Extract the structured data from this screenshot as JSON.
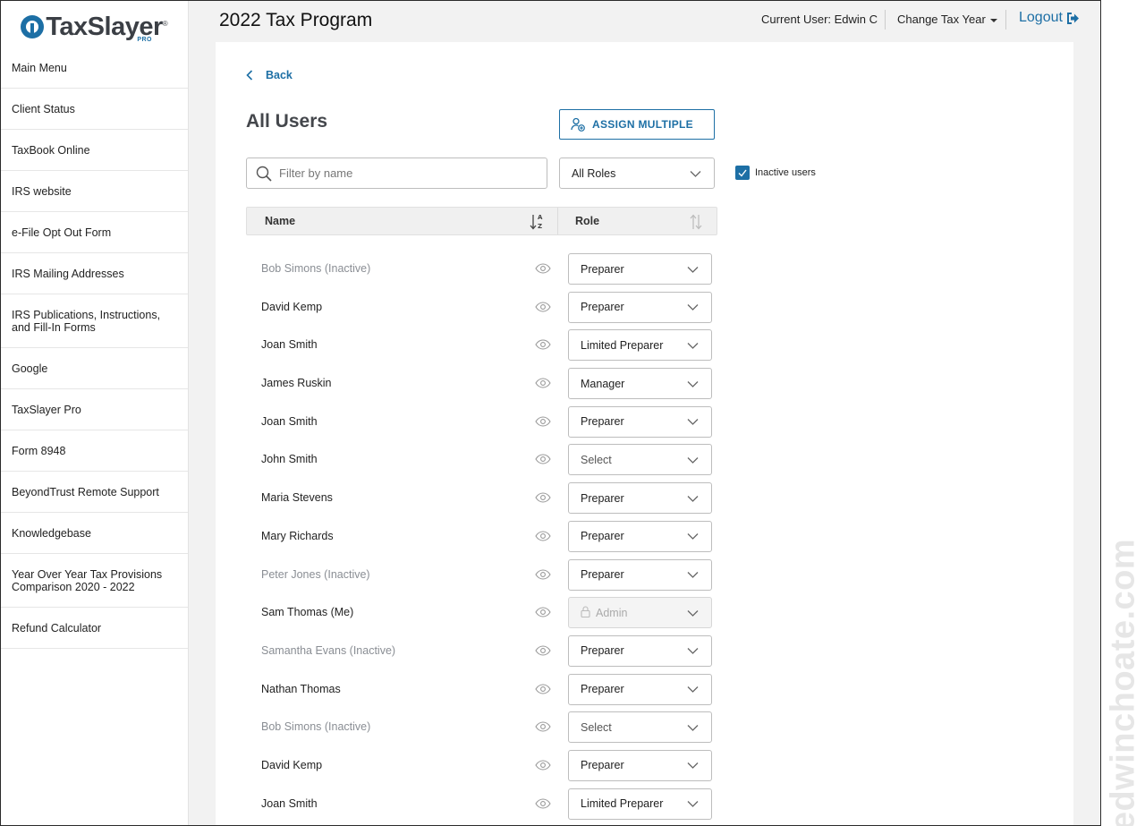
{
  "brand": {
    "name": "TaxSlayer",
    "reg": "®",
    "sub": "PRO"
  },
  "header": {
    "title": "2022 Tax Program",
    "current_user": "Current User: Edwin C",
    "change_year": "Change Tax Year",
    "logout": "Logout"
  },
  "sidebar": {
    "items": [
      {
        "label": "Main Menu"
      },
      {
        "label": "Client Status"
      },
      {
        "label": "TaxBook Online"
      },
      {
        "label": "IRS website"
      },
      {
        "label": "e-File Opt Out Form"
      },
      {
        "label": "IRS Mailing Addresses"
      },
      {
        "label": "IRS Publications, Instructions, and Fill-In Forms"
      },
      {
        "label": "Google"
      },
      {
        "label": "TaxSlayer Pro"
      },
      {
        "label": "Form 8948"
      },
      {
        "label": "BeyondTrust Remote Support"
      },
      {
        "label": "Knowledgebase"
      },
      {
        "label": "Year Over Year Tax Provisions Comparison 2020 - 2022"
      },
      {
        "label": "Refund Calculator"
      }
    ]
  },
  "main": {
    "back_label": "Back",
    "title": "All Users",
    "assign_label": "ASSIGN MULTIPLE",
    "filter_placeholder": "Filter by name",
    "roles_filter": "All Roles",
    "inactive_label": "Inactive users",
    "inactive_checked": true,
    "columns": {
      "name": "Name",
      "role": "Role"
    },
    "users": [
      {
        "name": "Bob Simons (Inactive)",
        "role": "Preparer",
        "inactive": true
      },
      {
        "name": "David Kemp",
        "role": "Preparer"
      },
      {
        "name": "Joan Smith",
        "role": "Limited Preparer"
      },
      {
        "name": "James Ruskin",
        "role": "Manager"
      },
      {
        "name": "Joan Smith",
        "role": "Preparer"
      },
      {
        "name": "John Smith",
        "role": "Select",
        "placeholder": true
      },
      {
        "name": "Maria Stevens",
        "role": "Preparer"
      },
      {
        "name": "Mary Richards",
        "role": "Preparer"
      },
      {
        "name": "Peter Jones (Inactive)",
        "role": "Preparer",
        "inactive": true
      },
      {
        "name": "Sam Thomas (Me)",
        "role": "Admin",
        "locked": true
      },
      {
        "name": "Samantha Evans (Inactive)",
        "role": "Preparer",
        "inactive": true
      },
      {
        "name": "Nathan Thomas",
        "role": "Preparer"
      },
      {
        "name": "Bob Simons (Inactive)",
        "role": "Select",
        "inactive": true,
        "placeholder": true
      },
      {
        "name": "David Kemp",
        "role": "Preparer"
      },
      {
        "name": "Joan Smith",
        "role": "Limited Preparer"
      }
    ]
  },
  "watermark": "edwinchoate.com",
  "colors": {
    "accent": "#1d6fa5",
    "inactive_text": "#8a8e94",
    "panel_bg": "#f2f2f2"
  }
}
